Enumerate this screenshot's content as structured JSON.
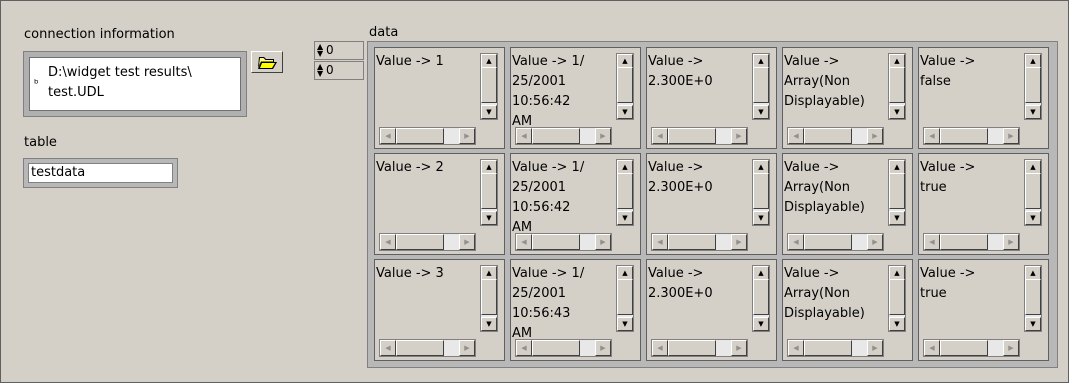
{
  "connection": {
    "label": "connection information",
    "path_line1": "D:\\widget test results\\",
    "path_line2": "test.UDL"
  },
  "table": {
    "label": "table",
    "value": "testdata"
  },
  "data": {
    "label": "data",
    "row_index": "0",
    "col_index": "0",
    "rows": [
      [
        "Value -> 1",
        "Value -> 1/\n25/2001\n10:56:42\nAM",
        "Value ->\n2.300E+0",
        "Value ->\nArray(Non\nDisplayable)",
        "Value ->\nfalse"
      ],
      [
        "Value -> 2",
        "Value -> 1/\n25/2001\n10:56:42\nAM",
        "Value ->\n2.300E+0",
        "Value ->\nArray(Non\nDisplayable)",
        "Value ->\ntrue"
      ],
      [
        "Value -> 3",
        "Value -> 1/\n25/2001\n10:56:43\nAM",
        "Value ->\n2.300E+0",
        "Value ->\nArray(Non\nDisplayable)",
        "Value ->\ntrue"
      ]
    ]
  },
  "icons": {
    "browse": "folder-open-icon",
    "connection": "tree-connector-icon"
  }
}
